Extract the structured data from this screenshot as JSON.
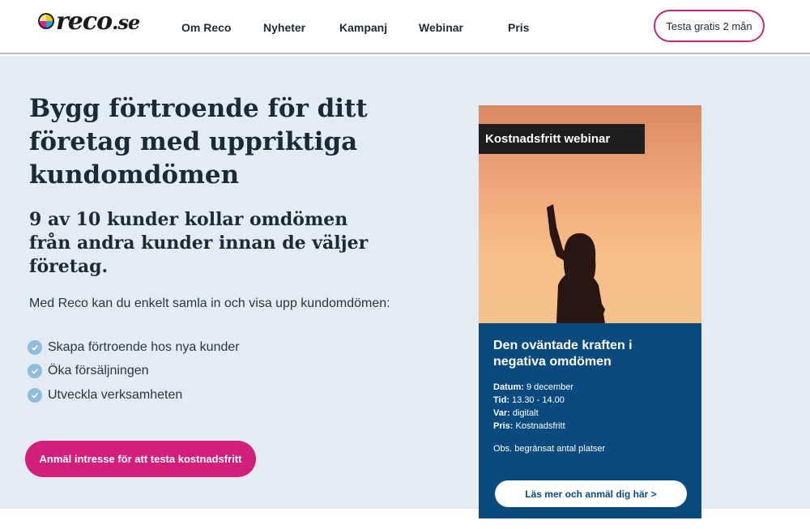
{
  "brand": {
    "logo_text": "reco",
    "logo_suffix": ".se"
  },
  "nav": {
    "items": [
      "Om Reco",
      "Nyheter",
      "Kampanj",
      "Webinar",
      "Pris"
    ],
    "cta_label": "Testa gratis 2 mån"
  },
  "hero": {
    "headline": "Bygg förtroende för ditt företag med uppriktiga kundomdömen",
    "subhead": "9 av 10 kunder kollar omdömen från andra kunder innan de väljer företag.",
    "intro": "Med Reco kan du enkelt samla in och visa upp kundomdömen:",
    "benefits": [
      "Skapa förtroende hos nya kunder",
      "Öka försäljningen",
      "Utveckla verksamheten"
    ],
    "cta_label": "Anmäl intresse för att testa kostnadsfritt"
  },
  "webinar": {
    "tag": "Kostnadsfritt webinar",
    "title": "Den oväntade kraften i negativa omdömen",
    "date_label": "Datum:",
    "date": " 9 december",
    "time_label": "Tid:",
    "time": " 13.30 - 14.00",
    "place_label": "Var:",
    "place": " digitalt",
    "price_label": "Pris:",
    "price": " Kostnadsfritt",
    "note": "Obs. begränsat antal platser",
    "cta_label": "Läs mer och anmäl dig här >"
  },
  "colors": {
    "accent": "#d21f79",
    "card_blue": "#0a4a7e",
    "hero_bg": "#e3ecf2",
    "check": "#8fbcd8"
  }
}
